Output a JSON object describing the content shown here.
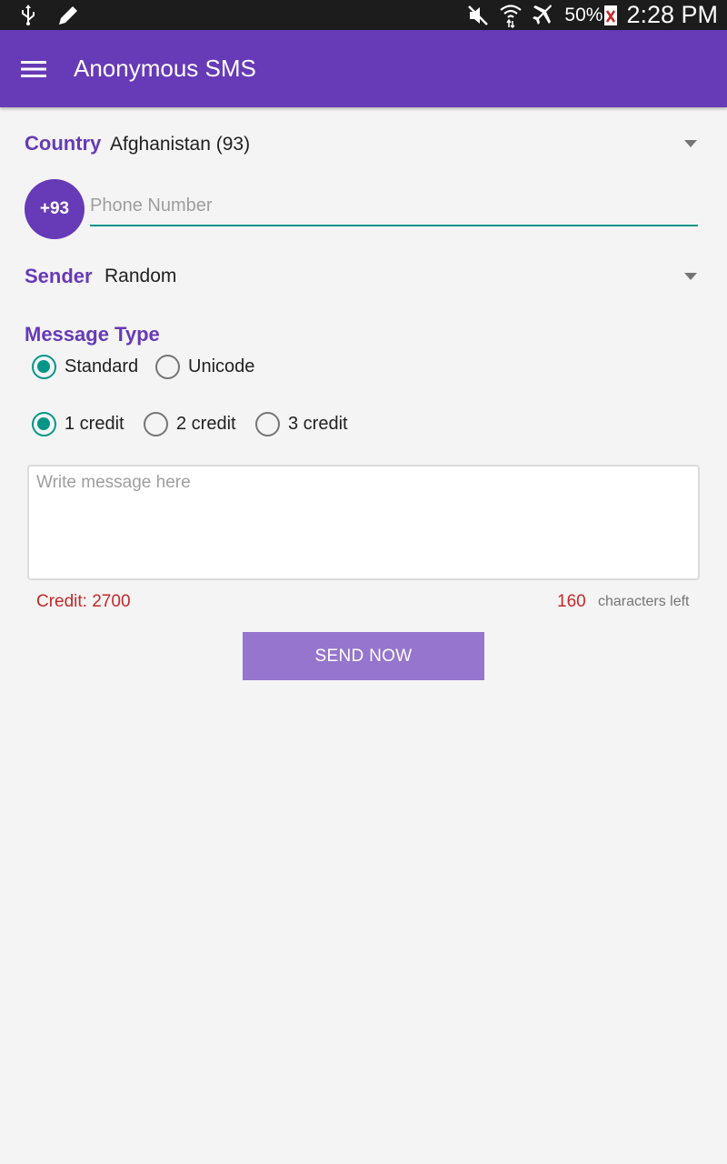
{
  "status_bar": {
    "left_icons": [
      "usb-icon",
      "edit-pencil-icon"
    ],
    "right_icons": [
      "mute-icon",
      "wifi-icon",
      "airplane-mode-icon",
      "battery-icon"
    ],
    "battery_percent": "50%",
    "time": "2:28 PM"
  },
  "app_bar": {
    "menu_icon": "hamburger-menu-icon",
    "title": "Anonymous SMS",
    "color": "#673ab7"
  },
  "form": {
    "country": {
      "label": "Country",
      "value": "Afghanistan (93)"
    },
    "phone": {
      "code_badge": "+93",
      "value": "",
      "placeholder": "Phone Number"
    },
    "sender": {
      "label": "Sender",
      "value": "Random"
    },
    "message_type": {
      "label": "Message Type",
      "options": [
        {
          "label": "Standard",
          "checked": true
        },
        {
          "label": "Unicode",
          "checked": false
        }
      ]
    },
    "credit_options": [
      {
        "label": "1 credit",
        "checked": true
      },
      {
        "label": "2 credit",
        "checked": false
      },
      {
        "label": "3 credit",
        "checked": false
      }
    ],
    "message": {
      "value": "",
      "placeholder": "Write message here"
    },
    "credit_text": "Credit: 2700",
    "chars_left_count": "160",
    "chars_left_label": "characters left",
    "send_label": "SEND NOW"
  },
  "colors": {
    "accent": "#009688",
    "primary": "#673ab7",
    "button": "#9575cd",
    "warning_text": "#c62828"
  }
}
